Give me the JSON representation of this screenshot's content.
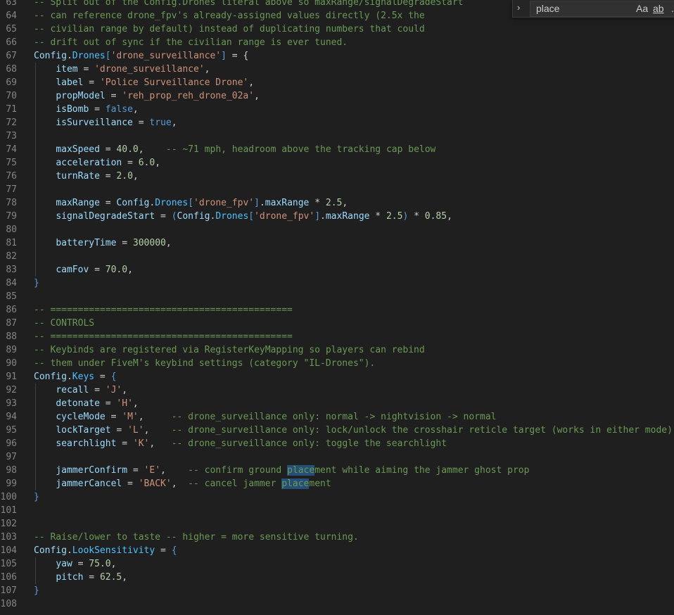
{
  "find": {
    "query": "place",
    "match_case_label": "Aa",
    "whole_word_label": "ab",
    "regex_label": ".*"
  },
  "lines": [
    {
      "n": "63",
      "t": [
        [
          "c",
          "-- Split out of the Config.Drones literal above so maxRange/signalDegradeStart"
        ]
      ]
    },
    {
      "n": "64",
      "t": [
        [
          "c",
          "-- can reference drone_fpv's already-assigned values directly (2.5x the"
        ]
      ]
    },
    {
      "n": "65",
      "t": [
        [
          "c",
          "-- civilian range by default) instead of duplicating numbers that could"
        ]
      ]
    },
    {
      "n": "66",
      "t": [
        [
          "c",
          "-- drift out of sync if the civilian range is ever tuned."
        ]
      ]
    },
    {
      "n": "67",
      "t": [
        [
          "v",
          "Config"
        ],
        [
          "p",
          "."
        ],
        [
          "f",
          "Drones"
        ],
        [
          "k",
          "["
        ],
        [
          "s",
          "'drone_surveillance'"
        ],
        [
          "k",
          "]"
        ],
        [
          "p",
          " = {"
        ]
      ]
    },
    {
      "n": "68",
      "t": [
        [
          "p",
          "    "
        ],
        [
          "v",
          "item"
        ],
        [
          "p",
          " = "
        ],
        [
          "s",
          "'drone_surveillance'"
        ],
        [
          "p",
          ","
        ]
      ]
    },
    {
      "n": "69",
      "t": [
        [
          "p",
          "    "
        ],
        [
          "v",
          "label"
        ],
        [
          "p",
          " = "
        ],
        [
          "s",
          "'Police Surveillance Drone'"
        ],
        [
          "p",
          ","
        ]
      ]
    },
    {
      "n": "70",
      "t": [
        [
          "p",
          "    "
        ],
        [
          "v",
          "propModel"
        ],
        [
          "p",
          " = "
        ],
        [
          "s",
          "'reh_prop_reh_drone_02a'"
        ],
        [
          "p",
          ","
        ]
      ]
    },
    {
      "n": "71",
      "t": [
        [
          "p",
          "    "
        ],
        [
          "v",
          "isBomb"
        ],
        [
          "p",
          " = "
        ],
        [
          "k",
          "false"
        ],
        [
          "p",
          ","
        ]
      ]
    },
    {
      "n": "72",
      "t": [
        [
          "p",
          "    "
        ],
        [
          "v",
          "isSurveillance"
        ],
        [
          "p",
          " = "
        ],
        [
          "k",
          "true"
        ],
        [
          "p",
          ","
        ]
      ]
    },
    {
      "n": "73",
      "t": []
    },
    {
      "n": "74",
      "t": [
        [
          "p",
          "    "
        ],
        [
          "v",
          "maxSpeed"
        ],
        [
          "p",
          " = "
        ],
        [
          "n",
          "40.0"
        ],
        [
          "p",
          ",    "
        ],
        [
          "c",
          "-- ~71 mph, headroom above the tracking cap below"
        ]
      ]
    },
    {
      "n": "75",
      "t": [
        [
          "p",
          "    "
        ],
        [
          "v",
          "acceleration"
        ],
        [
          "p",
          " = "
        ],
        [
          "n",
          "6.0"
        ],
        [
          "p",
          ","
        ]
      ]
    },
    {
      "n": "76",
      "t": [
        [
          "p",
          "    "
        ],
        [
          "v",
          "turnRate"
        ],
        [
          "p",
          " = "
        ],
        [
          "n",
          "2.0"
        ],
        [
          "p",
          ","
        ]
      ]
    },
    {
      "n": "77",
      "t": []
    },
    {
      "n": "78",
      "t": [
        [
          "p",
          "    "
        ],
        [
          "v",
          "maxRange"
        ],
        [
          "p",
          " = "
        ],
        [
          "v",
          "Config"
        ],
        [
          "p",
          "."
        ],
        [
          "f",
          "Drones"
        ],
        [
          "k",
          "["
        ],
        [
          "s",
          "'drone_fpv'"
        ],
        [
          "k",
          "]"
        ],
        [
          "p",
          "."
        ],
        [
          "v",
          "maxRange"
        ],
        [
          "p",
          " * "
        ],
        [
          "n",
          "2.5"
        ],
        [
          "p",
          ","
        ]
      ]
    },
    {
      "n": "79",
      "t": [
        [
          "p",
          "    "
        ],
        [
          "v",
          "signalDegradeStart"
        ],
        [
          "p",
          " = "
        ],
        [
          "k",
          "("
        ],
        [
          "v",
          "Config"
        ],
        [
          "p",
          "."
        ],
        [
          "f",
          "Drones"
        ],
        [
          "k",
          "["
        ],
        [
          "s",
          "'drone_fpv'"
        ],
        [
          "k",
          "]"
        ],
        [
          "p",
          "."
        ],
        [
          "v",
          "maxRange"
        ],
        [
          "p",
          " * "
        ],
        [
          "n",
          "2.5"
        ],
        [
          "k",
          ")"
        ],
        [
          "p",
          " * "
        ],
        [
          "n",
          "0.85"
        ],
        [
          "p",
          ","
        ]
      ]
    },
    {
      "n": "80",
      "t": []
    },
    {
      "n": "81",
      "t": [
        [
          "p",
          "    "
        ],
        [
          "v",
          "batteryTime"
        ],
        [
          "p",
          " = "
        ],
        [
          "n",
          "300000"
        ],
        [
          "p",
          ","
        ]
      ]
    },
    {
      "n": "82",
      "t": []
    },
    {
      "n": "83",
      "t": [
        [
          "p",
          "    "
        ],
        [
          "v",
          "camFov"
        ],
        [
          "p",
          " = "
        ],
        [
          "n",
          "70.0"
        ],
        [
          "p",
          ","
        ]
      ]
    },
    {
      "n": "84",
      "t": [
        [
          "k",
          "}"
        ]
      ]
    },
    {
      "n": "85",
      "t": []
    },
    {
      "n": "86",
      "t": [
        [
          "c",
          "-- ============================================"
        ]
      ]
    },
    {
      "n": "87",
      "t": [
        [
          "c",
          "-- CONTROLS"
        ]
      ]
    },
    {
      "n": "88",
      "t": [
        [
          "c",
          "-- ============================================"
        ]
      ]
    },
    {
      "n": "89",
      "t": [
        [
          "c",
          "-- Keybinds are registered via RegisterKeyMapping so players can rebind"
        ]
      ]
    },
    {
      "n": "90",
      "t": [
        [
          "c",
          "-- them under FiveM's keybind settings (category \"IL-Drones\")."
        ]
      ]
    },
    {
      "n": "91",
      "t": [
        [
          "v",
          "Config"
        ],
        [
          "p",
          "."
        ],
        [
          "f",
          "Keys"
        ],
        [
          "p",
          " = "
        ],
        [
          "k",
          "{"
        ]
      ]
    },
    {
      "n": "92",
      "t": [
        [
          "p",
          "    "
        ],
        [
          "v",
          "recall"
        ],
        [
          "p",
          " = "
        ],
        [
          "s",
          "'J'"
        ],
        [
          "p",
          ","
        ]
      ]
    },
    {
      "n": "93",
      "t": [
        [
          "p",
          "    "
        ],
        [
          "v",
          "detonate"
        ],
        [
          "p",
          " = "
        ],
        [
          "s",
          "'H'"
        ],
        [
          "p",
          ","
        ]
      ]
    },
    {
      "n": "94",
      "t": [
        [
          "p",
          "    "
        ],
        [
          "v",
          "cycleMode"
        ],
        [
          "p",
          " = "
        ],
        [
          "s",
          "'M'"
        ],
        [
          "p",
          ",     "
        ],
        [
          "c",
          "-- drone_surveillance only: normal -> nightvision -> normal"
        ]
      ]
    },
    {
      "n": "95",
      "t": [
        [
          "p",
          "    "
        ],
        [
          "v",
          "lockTarget"
        ],
        [
          "p",
          " = "
        ],
        [
          "s",
          "'L'"
        ],
        [
          "p",
          ",    "
        ],
        [
          "c",
          "-- drone_surveillance only: lock/unlock the crosshair reticle target (works in either mode)"
        ]
      ]
    },
    {
      "n": "96",
      "t": [
        [
          "p",
          "    "
        ],
        [
          "v",
          "searchlight"
        ],
        [
          "p",
          " = "
        ],
        [
          "s",
          "'K'"
        ],
        [
          "p",
          ",   "
        ],
        [
          "c",
          "-- drone_surveillance only: toggle the searchlight"
        ]
      ]
    },
    {
      "n": "97",
      "t": []
    },
    {
      "n": "98",
      "t": [
        [
          "p",
          "    "
        ],
        [
          "v",
          "jammerConfirm"
        ],
        [
          "p",
          " = "
        ],
        [
          "s",
          "'E'"
        ],
        [
          "p",
          ",    "
        ],
        [
          "c",
          "-- confirm ground "
        ],
        [
          "ch",
          "place"
        ],
        [
          "c",
          "ment while aiming the jammer ghost prop"
        ]
      ]
    },
    {
      "n": "99",
      "t": [
        [
          "p",
          "    "
        ],
        [
          "v",
          "jammerCancel"
        ],
        [
          "p",
          " = "
        ],
        [
          "s",
          "'BACK'"
        ],
        [
          "p",
          ",  "
        ],
        [
          "c",
          "-- cancel jammer "
        ],
        [
          "ch",
          "place"
        ],
        [
          "c",
          "ment"
        ]
      ]
    },
    {
      "n": "100",
      "t": [
        [
          "k",
          "}"
        ]
      ]
    },
    {
      "n": "101",
      "t": []
    },
    {
      "n": "102",
      "t": []
    },
    {
      "n": "103",
      "t": [
        [
          "c",
          "-- Raise/lower to taste -- higher = more sensitive turning."
        ]
      ]
    },
    {
      "n": "104",
      "t": [
        [
          "v",
          "Config"
        ],
        [
          "p",
          "."
        ],
        [
          "f",
          "LookSensitivity"
        ],
        [
          "p",
          " = "
        ],
        [
          "k",
          "{"
        ]
      ]
    },
    {
      "n": "105",
      "t": [
        [
          "p",
          "    "
        ],
        [
          "v",
          "yaw"
        ],
        [
          "p",
          " = "
        ],
        [
          "n",
          "75.0"
        ],
        [
          "p",
          ","
        ]
      ]
    },
    {
      "n": "106",
      "t": [
        [
          "p",
          "    "
        ],
        [
          "v",
          "pitch"
        ],
        [
          "p",
          " = "
        ],
        [
          "n",
          "62.5"
        ],
        [
          "p",
          ","
        ]
      ]
    },
    {
      "n": "107",
      "t": [
        [
          "k",
          "}"
        ]
      ]
    },
    {
      "n": "108",
      "t": []
    }
  ],
  "colors": {
    "background": "#1f1f1f",
    "comment": "#6a9955",
    "identifier": "#9cdcfe",
    "keyword": "#569cd6",
    "string": "#ce9178",
    "number": "#b5cea8",
    "find_highlight": "#264f78"
  }
}
